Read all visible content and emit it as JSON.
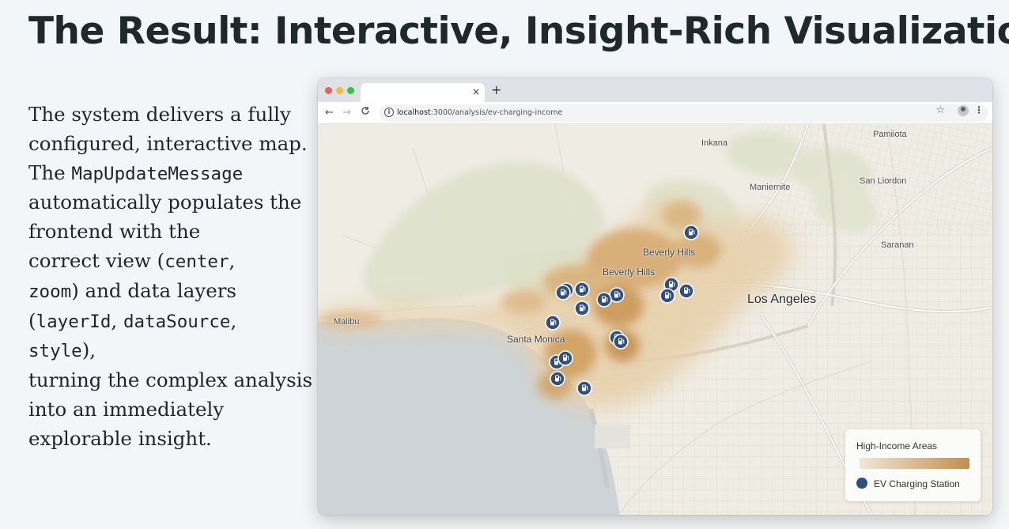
{
  "slide": {
    "title": "The Result: Interactive, Insight-Rich Visualization",
    "body": [
      {
        "text": "The system delivers a fully"
      },
      {
        "text": "configured, interactive map."
      },
      {
        "text": "The ",
        "code": "MapUpdateMessage"
      },
      {
        "text": "automatically populates the"
      },
      {
        "text": "frontend with the"
      },
      {
        "text": "correct view (",
        "code": "center",
        "after": ","
      },
      {
        "code": " zoom",
        "text2": ") and data layers"
      },
      {
        "text": "(",
        "code": "layerId",
        "after": ", ",
        "code2": "dataSource",
        "after2": ","
      },
      {
        "code": " style",
        "after": "),"
      },
      {
        "text": "turning the complex analysis"
      },
      {
        "text": "into an immediately"
      },
      {
        "text": "explorable insight."
      }
    ]
  },
  "browser": {
    "tab_close": "×",
    "new_tab": "+",
    "nav_back": "←",
    "nav_forward": "→",
    "nav_reload": "C",
    "info": "i",
    "url_host": "localhost",
    "url_path": ":3000/analysis/ev-charging-income",
    "star": "☆",
    "menu": "⋮"
  },
  "map": {
    "labels": {
      "inkana": "Inkana",
      "pamiiota": "Pamiiota",
      "maniernite": "Maniernite",
      "san_liordon": "San Liordon",
      "saranan": "Saranan",
      "beverly_hills_1": "Beverly Hills",
      "beverly_hills_2": "Beverly Hills",
      "los_angeles": "Los Angeles",
      "malibu": "Malibu",
      "santa_monica": "Santa Monica"
    },
    "colors": {
      "land": "#efece4",
      "water": "#cdd3d6",
      "park": "#dfe2cd",
      "heat": "#c58a3e",
      "station": "#2f4f7e"
    },
    "station_count": 17
  },
  "legend": {
    "title": "High-Income Areas",
    "station_label": "EV Charging Station",
    "gradient_start": "#f1e6d6",
    "gradient_end": "#c38e4c",
    "station_color": "#2f4f7e"
  }
}
